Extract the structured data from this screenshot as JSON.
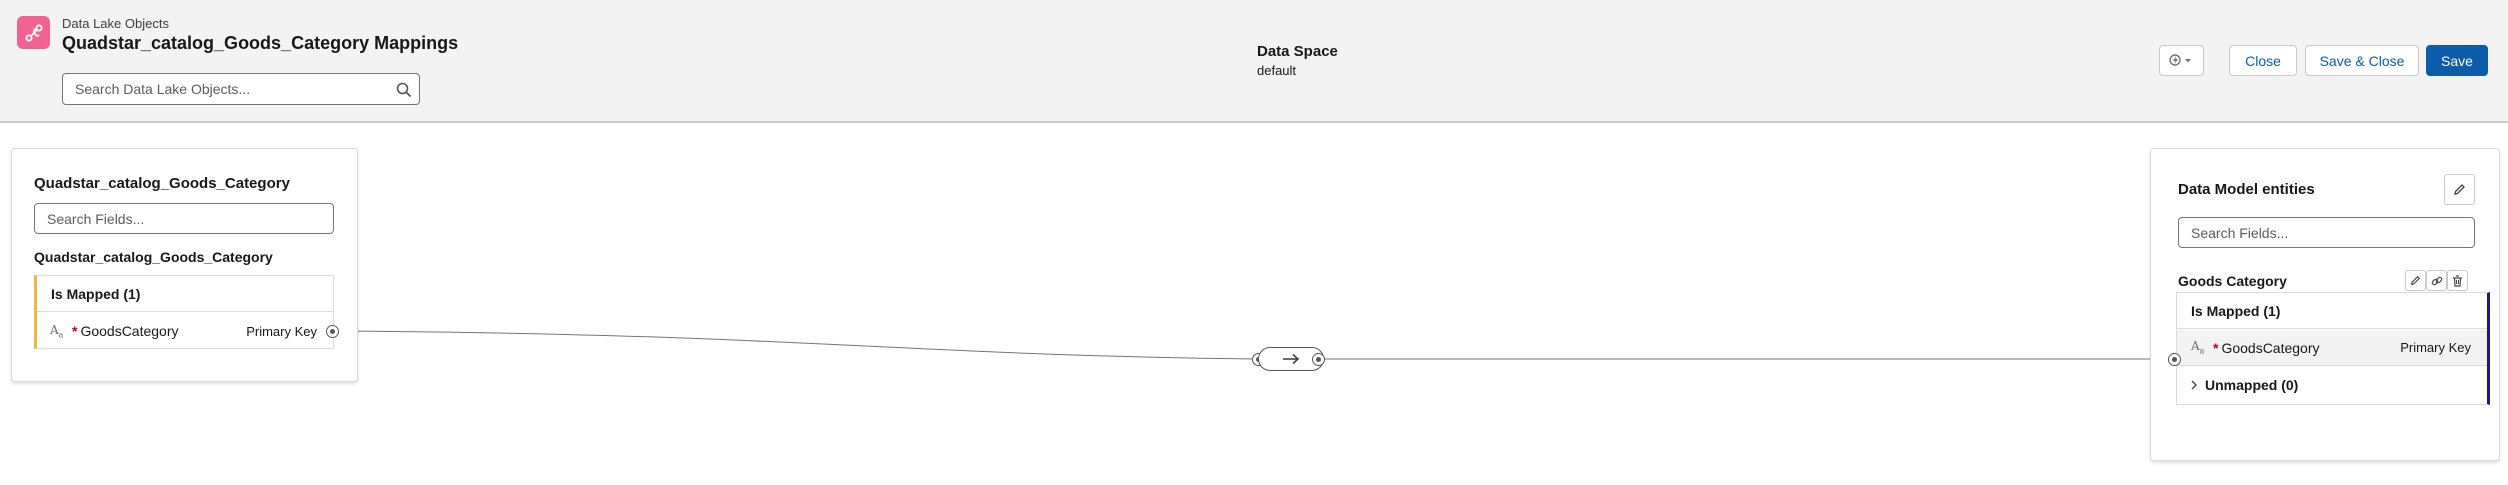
{
  "header": {
    "object_type": "Data Lake Objects",
    "title": "Quadstar_catalog_Goods_Category Mappings",
    "search_placeholder": "Search Data Lake Objects...",
    "data_space_label": "Data Space",
    "data_space_value": "default",
    "buttons": {
      "close": "Close",
      "save_close": "Save & Close",
      "save": "Save"
    },
    "icons": {
      "app": "mapping-icon",
      "search": "search-icon",
      "menu": "lightning-dropdown-icon"
    }
  },
  "source_panel": {
    "title": "Quadstar_catalog_Goods_Category",
    "search_placeholder": "Search Fields...",
    "object_name": "Quadstar_catalog_Goods_Category",
    "mapped_section": "Is Mapped (1)",
    "fields": [
      {
        "type_icon": "text-type-icon",
        "required": "*",
        "name": "GoodsCategory",
        "key": "Primary Key"
      }
    ]
  },
  "target_panel": {
    "title": "Data Model entities",
    "search_placeholder": "Search Fields...",
    "entity_name": "Goods Category",
    "mapped_section": "Is Mapped (1)",
    "unmapped_section": "Unmapped (0)",
    "fields": [
      {
        "type_icon": "text-type-icon",
        "required": "*",
        "name": "GoodsCategory",
        "key": "Primary Key"
      }
    ]
  },
  "colors": {
    "brand": "#0b5cab",
    "app_icon": "#f06292",
    "mapped_accent_left": "#f0b73e",
    "mapped_accent_right": "#1b1b7a",
    "header_bg": "#f3f3f3"
  }
}
